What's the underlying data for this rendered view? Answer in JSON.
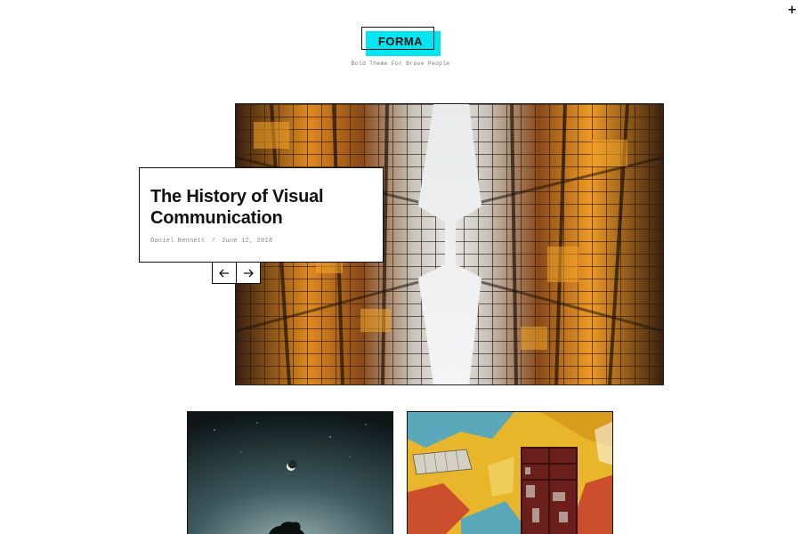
{
  "header": {
    "plus_icon": "plus-icon",
    "logo_text": "FORMA",
    "tagline": "Bold Theme For Brave People",
    "accent_color": "#00e5f2"
  },
  "featured_post": {
    "title": "The History of Visual Communication",
    "author": "Daniel Bennett",
    "separator": "/",
    "date": "June 12, 2018",
    "image_icon": "skyscrapers-photo"
  },
  "slider": {
    "prev_icon": "arrow-left-icon",
    "next_icon": "arrow-right-icon"
  },
  "grid": {
    "items": [
      {
        "image_icon": "night-sky-moon-photo"
      },
      {
        "image_icon": "colorful-wall-window-photo"
      }
    ]
  }
}
